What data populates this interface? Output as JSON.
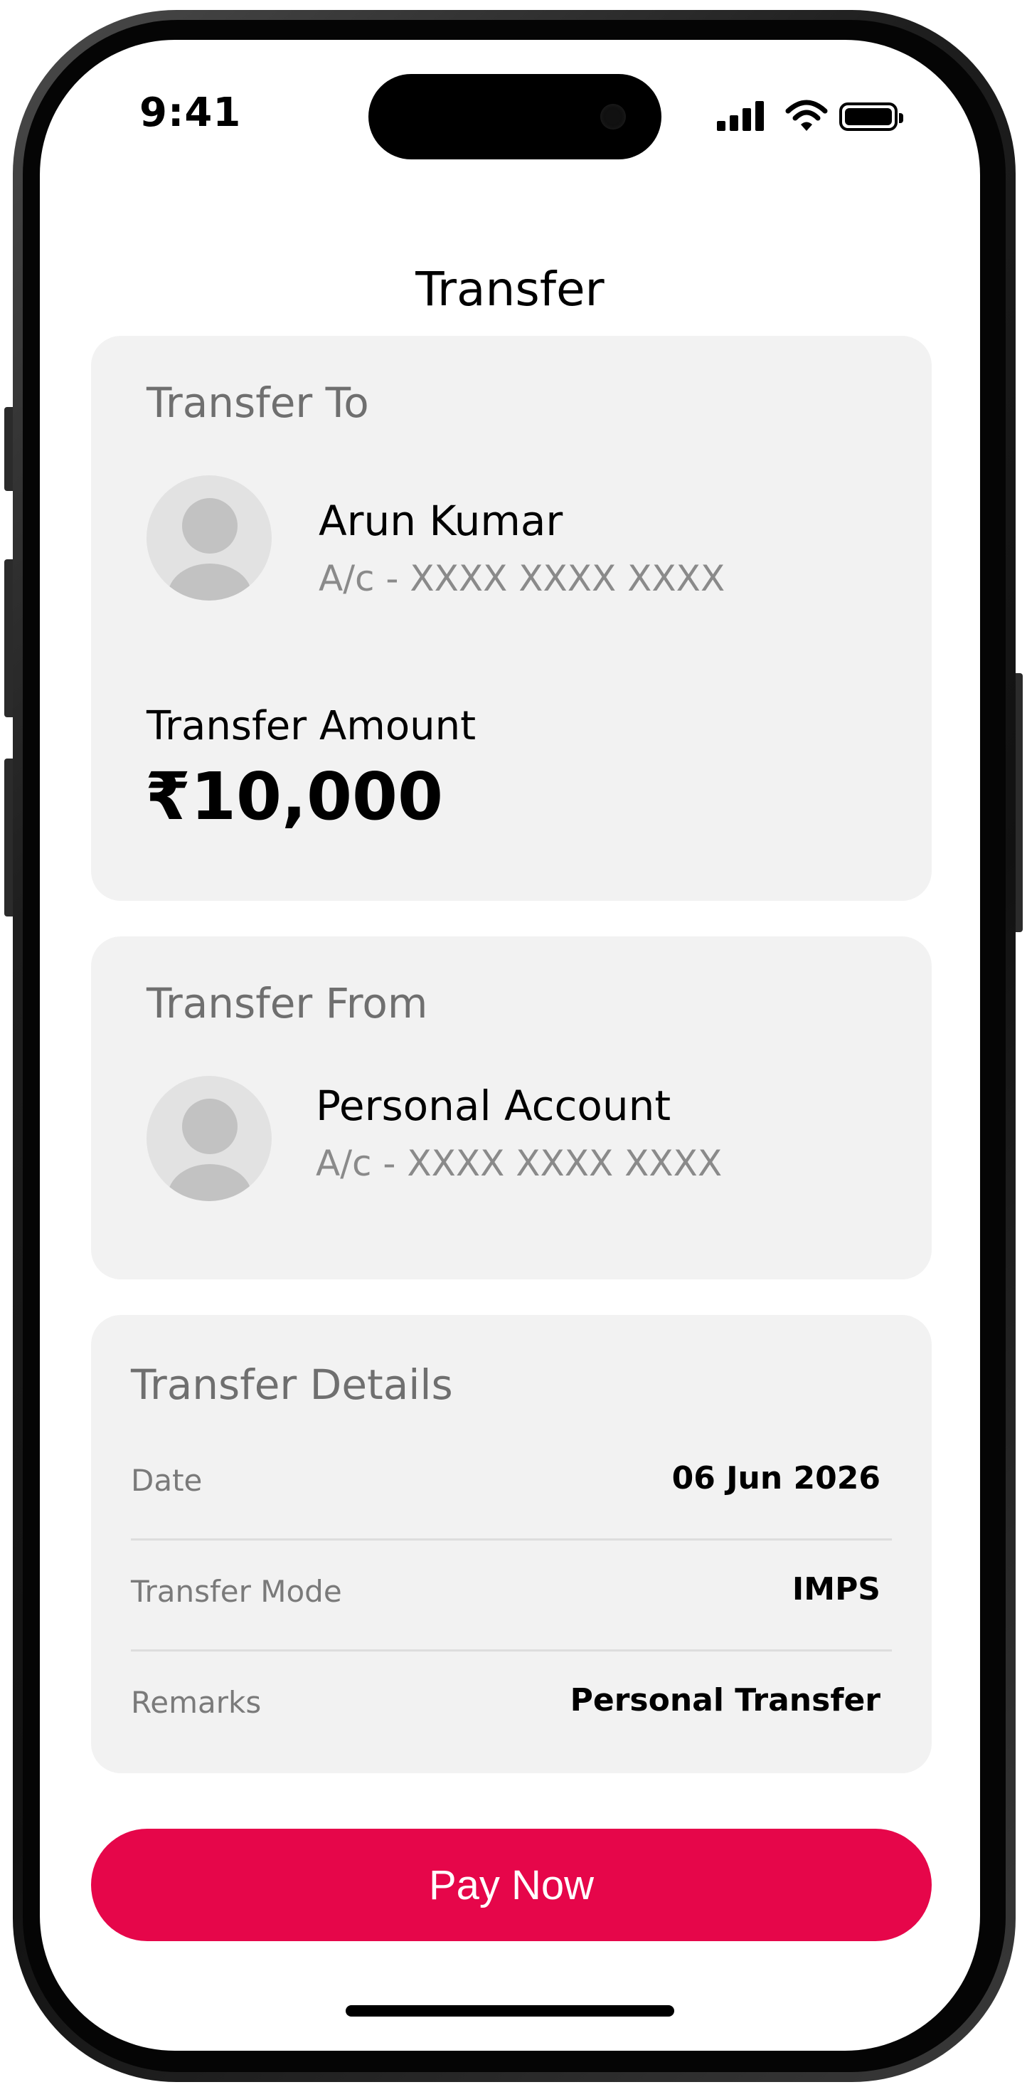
{
  "status_bar": {
    "time": "9:41"
  },
  "header": {
    "title": "Transfer"
  },
  "transfer_to": {
    "heading": "Transfer To",
    "name": "Arun Kumar",
    "account": "A/c - XXXX XXXX XXXX",
    "amount_label": "Transfer Amount",
    "amount": "₹10,000"
  },
  "transfer_from": {
    "heading": "Transfer From",
    "name": "Personal Account",
    "account": "A/c - XXXX XXXX XXXX"
  },
  "transfer_details": {
    "heading": "Transfer Details",
    "rows": [
      {
        "label": "Date",
        "value": "06 Jun 2026"
      },
      {
        "label": "Transfer Mode",
        "value": "IMPS"
      },
      {
        "label": "Remarks",
        "value": "Personal Transfer"
      }
    ]
  },
  "actions": {
    "pay_label": "Pay Now"
  },
  "colors": {
    "accent": "#e6064a",
    "card_bg": "#f2f2f2",
    "muted_text": "#6f6f6f"
  },
  "icons": [
    "signal-icon",
    "wifi-icon",
    "battery-icon",
    "avatar-icon"
  ]
}
